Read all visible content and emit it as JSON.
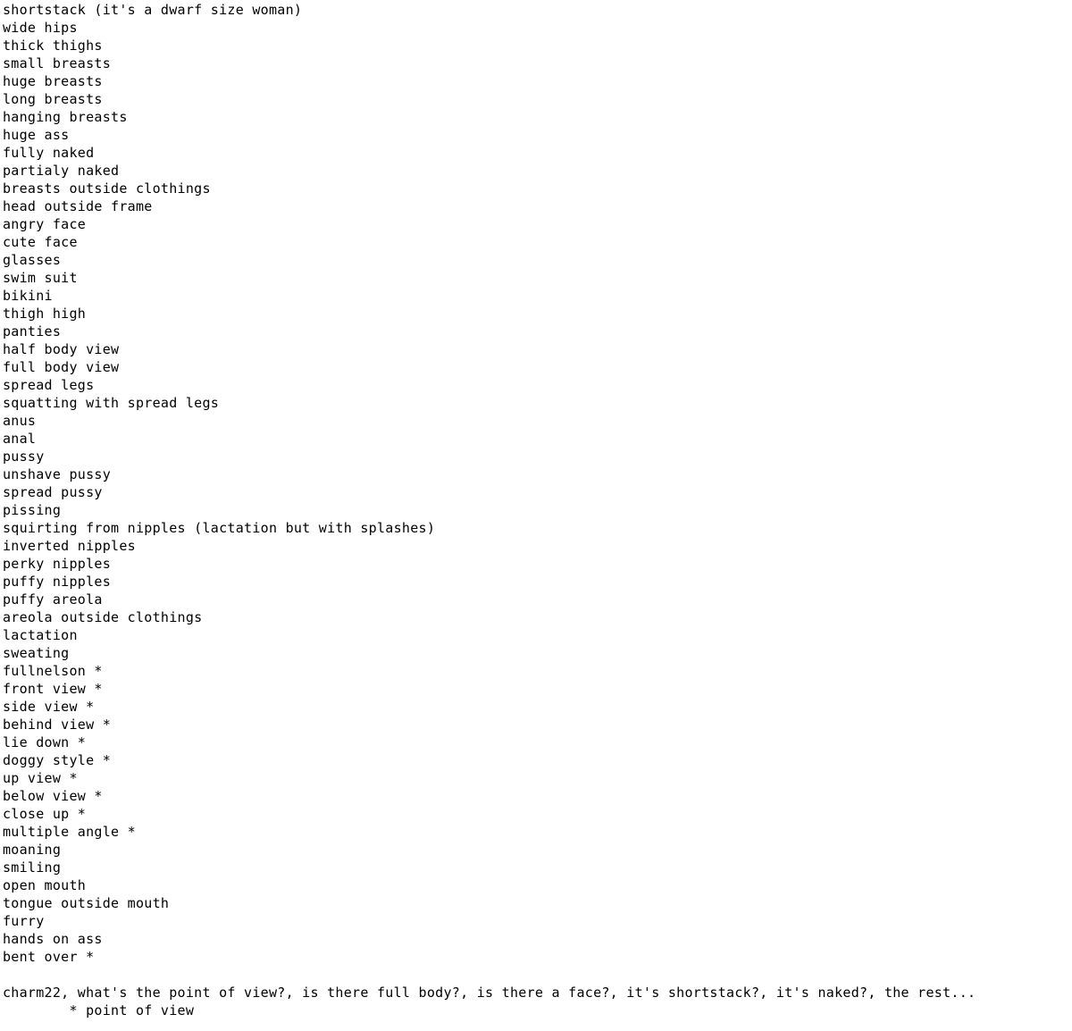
{
  "document": {
    "background_color": "#ffffff",
    "text_color": "#000000",
    "tag_list": [
      "shortstack (it's a dwarf size woman)",
      "wide hips",
      "thick thighs",
      "small breasts",
      "huge breasts",
      "long breasts",
      "hanging breasts",
      "huge ass",
      "fully naked",
      "partialy naked",
      "breasts outside clothings",
      "head outside frame",
      "angry face",
      "cute face",
      "glasses",
      "swim suit",
      "bikini",
      "thigh high",
      "panties",
      "half body view",
      "full body view",
      "spread legs",
      "squatting with spread legs",
      "anus",
      "anal",
      "pussy",
      "unshave pussy",
      "spread pussy",
      "pissing",
      "squirting from nipples (lactation but with splashes)",
      "inverted nipples",
      "perky nipples",
      "puffy nipples",
      "puffy areola",
      "areola outside clothings",
      "lactation",
      "sweating",
      "fullnelson *",
      "front view *",
      "side view *",
      "behind view *",
      "lie down *",
      "doggy style *",
      "up view *",
      "below view *",
      "close up *",
      "multiple angle *",
      "moaning",
      "smiling",
      "open mouth",
      "tongue outside mouth",
      "furry",
      "hands on ass",
      "bent over *"
    ],
    "footer": {
      "question_line": "charm22, what's the point of view?, is there full body?, is there a face?, it's shortstack?, it's naked?, the rest...",
      "legend_line": "        * point of view"
    }
  }
}
